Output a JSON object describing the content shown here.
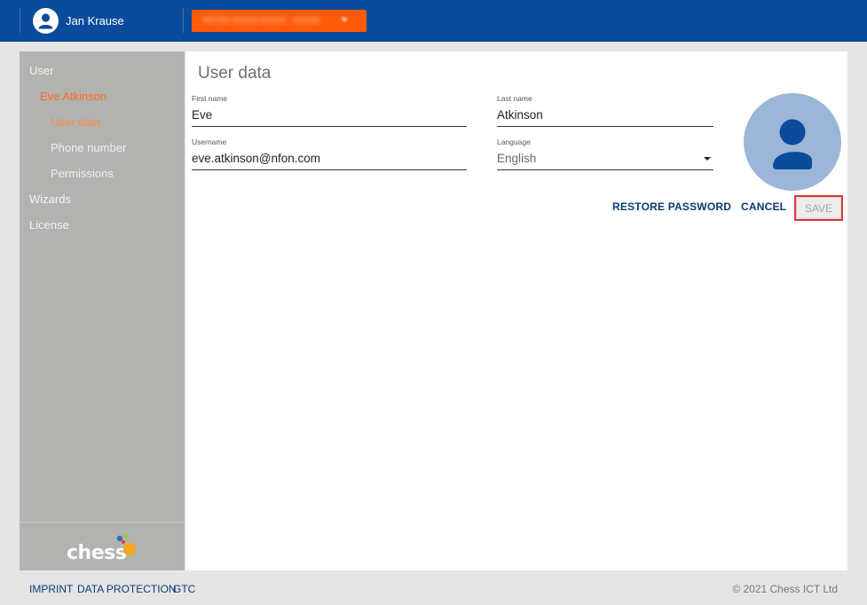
{
  "header": {
    "user_name": "Jan Krause",
    "tenant_label": "NFON AAAA AAAA · AAAA",
    "user_icon": "user-circle-icon",
    "caret_icon": "chevron-down-icon"
  },
  "sidebar": {
    "items": [
      {
        "label": "User"
      },
      {
        "label": "Eve Atkinson"
      },
      {
        "label": "User data"
      },
      {
        "label": "Phone number"
      },
      {
        "label": "Permissions"
      },
      {
        "label": "Wizards"
      },
      {
        "label": "License"
      }
    ],
    "logo_text": "chess"
  },
  "main": {
    "title": "User data",
    "fields": {
      "first_name": {
        "label": "First name",
        "value": "Eve"
      },
      "last_name": {
        "label": "Last name",
        "value": "Atkinson"
      },
      "username": {
        "label": "Username",
        "value": "eve.atkinson@nfon.com"
      },
      "language": {
        "label": "Language",
        "value": "English"
      }
    },
    "avatar_icon": "user-avatar-icon",
    "actions": {
      "restore_password": "RESTORE PASSWORD",
      "cancel": "CANCEL",
      "save": "SAVE"
    }
  },
  "footer": {
    "links": [
      "IMPRINT",
      "DATA PROTECTION",
      "GTC"
    ],
    "copyright": "© 2021 Chess ICT Ltd"
  },
  "colors": {
    "header_bg": "#0a4b9b",
    "accent_orange": "#ff5a0a",
    "sidebar_bg": "#b2b2b0",
    "link_blue": "#0c3a78",
    "avatar_bg": "#9cb6d7"
  }
}
